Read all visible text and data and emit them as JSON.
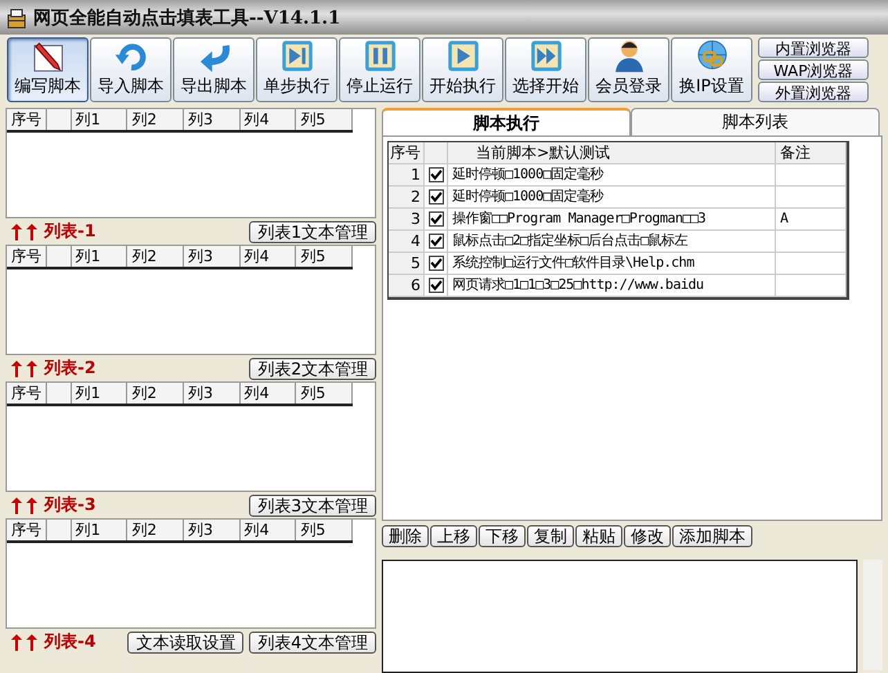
{
  "window": {
    "title": "网页全能自动点击填表工具--V14.1.1"
  },
  "toolbar": [
    {
      "label": "编写脚本",
      "selected": true
    },
    {
      "label": "导入脚本",
      "selected": false
    },
    {
      "label": "导出脚本",
      "selected": false
    },
    {
      "label": "单步执行",
      "selected": false
    },
    {
      "label": "停止运行",
      "selected": false
    },
    {
      "label": "开始执行",
      "selected": false
    },
    {
      "label": "选择开始",
      "selected": false
    },
    {
      "label": "会员登录",
      "selected": false
    },
    {
      "label": "换IP设置",
      "selected": false
    }
  ],
  "browser_buttons": [
    "内置浏览器",
    "WAP浏览器",
    "外置浏览器"
  ],
  "lists": [
    {
      "columns": [
        "序号",
        "列1",
        "列2",
        "列3",
        "列4",
        "列5"
      ],
      "title": "列表-1",
      "buttons": [
        "列表1文本管理"
      ]
    },
    {
      "columns": [
        "序号",
        "列1",
        "列2",
        "列3",
        "列4",
        "列5"
      ],
      "title": "列表-2",
      "buttons": [
        "列表2文本管理"
      ]
    },
    {
      "columns": [
        "序号",
        "列1",
        "列2",
        "列3",
        "列4",
        "列5"
      ],
      "title": "列表-3",
      "buttons": [
        "列表3文本管理"
      ]
    },
    {
      "columns": [
        "序号",
        "列1",
        "列2",
        "列3",
        "列4",
        "列5"
      ],
      "title": "列表-4",
      "buttons": [
        "文本读取设置",
        "列表4文本管理"
      ]
    }
  ],
  "script_panel": {
    "tabs": [
      {
        "label": "脚本执行",
        "selected": true
      },
      {
        "label": "脚本列表",
        "selected": false
      }
    ],
    "columns": [
      "序号",
      "当前脚本>默认测试",
      "备注"
    ],
    "rows": [
      {
        "index": "1",
        "checked": true,
        "script": "延时停顿□1000□固定毫秒"
      },
      {
        "index": "2",
        "checked": true,
        "script": "延时停顿□1000□固定毫秒"
      },
      {
        "index": "3",
        "checked": true,
        "script": "操作窗□□Program Manager□Progman□□3",
        "note": "A"
      },
      {
        "index": "4",
        "checked": true,
        "script": "鼠标点击□2□指定坐标□后台点击□鼠标左"
      },
      {
        "index": "5",
        "checked": true,
        "script": "系统控制□运行文件□软件目录\\Help.chm"
      },
      {
        "index": "6",
        "checked": true,
        "script": "网页请求□1□1□3□25□http://www.baidu"
      }
    ],
    "buttons": [
      "删除",
      "上移",
      "下移",
      "复制",
      "粘贴",
      "修改",
      "添加脚本"
    ]
  }
}
